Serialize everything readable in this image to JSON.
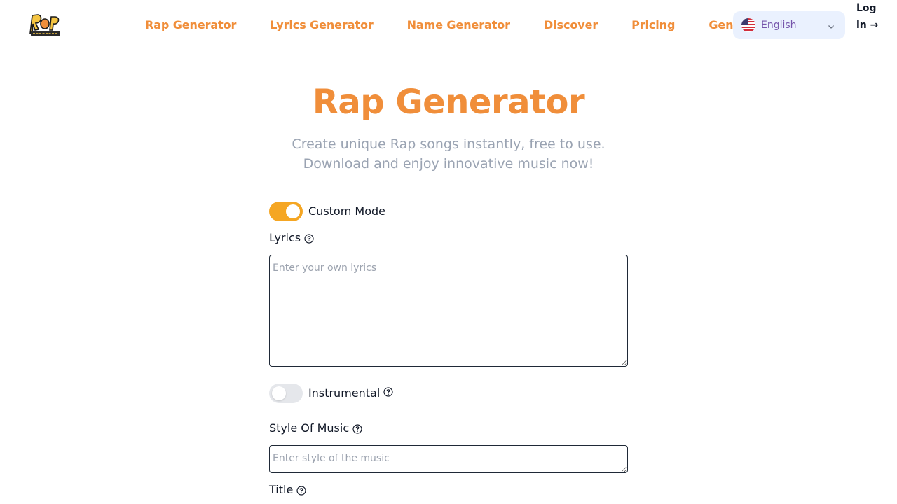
{
  "nav": {
    "items": [
      "Rap Generator",
      "Lyrics Generator",
      "Name Generator",
      "Discover",
      "Pricing",
      "Generation"
    ]
  },
  "language": {
    "selected": "English",
    "flag_icon": "us-flag-icon"
  },
  "login": {
    "label": "Log in →"
  },
  "hero": {
    "title": "Rap Generator",
    "subtitle": "Create unique Rap songs instantly, free to use. Download and enjoy innovative music now!"
  },
  "form": {
    "custom_mode": {
      "label": "Custom Mode",
      "on": true
    },
    "lyrics": {
      "label": "Lyrics",
      "placeholder": "Enter your own lyrics",
      "value": ""
    },
    "instrumental": {
      "label": "Instrumental",
      "on": false
    },
    "style": {
      "label": "Style Of Music",
      "placeholder": "Enter style of the music",
      "value": ""
    },
    "title": {
      "label": "Title"
    }
  },
  "colors": {
    "accent": "#f08e3a",
    "toggle_on": "#f5a623",
    "lang_bg": "#eaf1fe",
    "lang_text": "#7655ab"
  }
}
